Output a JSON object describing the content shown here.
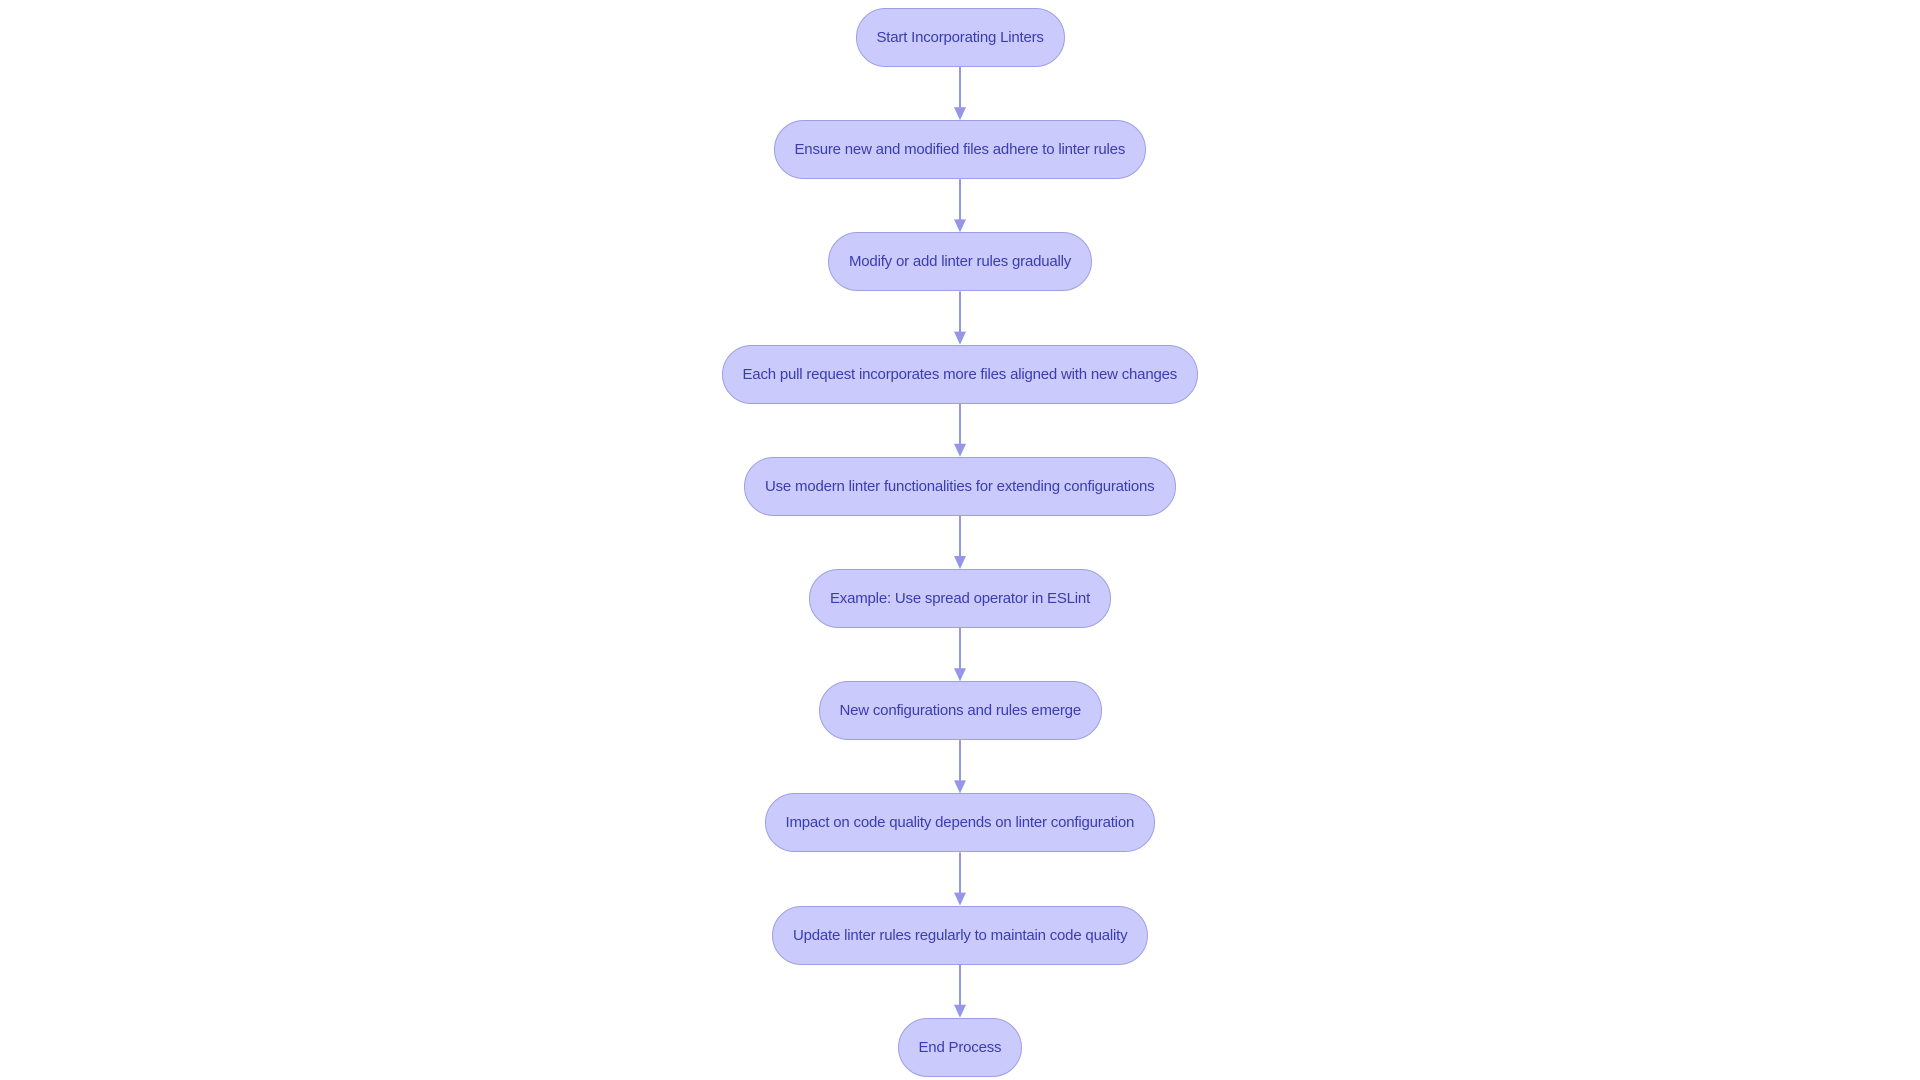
{
  "diagram": {
    "type": "flowchart",
    "direction": "top-to-bottom",
    "colors": {
      "node_fill": "#CACBFC",
      "node_stroke": "#9D9FE6",
      "edge": "#9596E6",
      "text": "#3A3CB0"
    },
    "nodes": [
      {
        "id": "n1",
        "label": "Start Incorporating Linters"
      },
      {
        "id": "n2",
        "label": "Ensure new and modified files adhere to linter rules"
      },
      {
        "id": "n3",
        "label": "Modify or add linter rules gradually"
      },
      {
        "id": "n4",
        "label": "Each pull request incorporates more files aligned with new changes"
      },
      {
        "id": "n5",
        "label": "Use modern linter functionalities for extending configurations"
      },
      {
        "id": "n6",
        "label": "Example: Use spread operator in ESLint"
      },
      {
        "id": "n7",
        "label": "New configurations and rules emerge"
      },
      {
        "id": "n8",
        "label": "Impact on code quality depends on linter configuration"
      },
      {
        "id": "n9",
        "label": "Update linter rules regularly to maintain code quality"
      },
      {
        "id": "n10",
        "label": "End Process"
      }
    ],
    "edges": [
      {
        "from": "n1",
        "to": "n2"
      },
      {
        "from": "n2",
        "to": "n3"
      },
      {
        "from": "n3",
        "to": "n4"
      },
      {
        "from": "n4",
        "to": "n5"
      },
      {
        "from": "n5",
        "to": "n6"
      },
      {
        "from": "n6",
        "to": "n7"
      },
      {
        "from": "n7",
        "to": "n8"
      },
      {
        "from": "n8",
        "to": "n9"
      },
      {
        "from": "n9",
        "to": "n10"
      }
    ]
  }
}
